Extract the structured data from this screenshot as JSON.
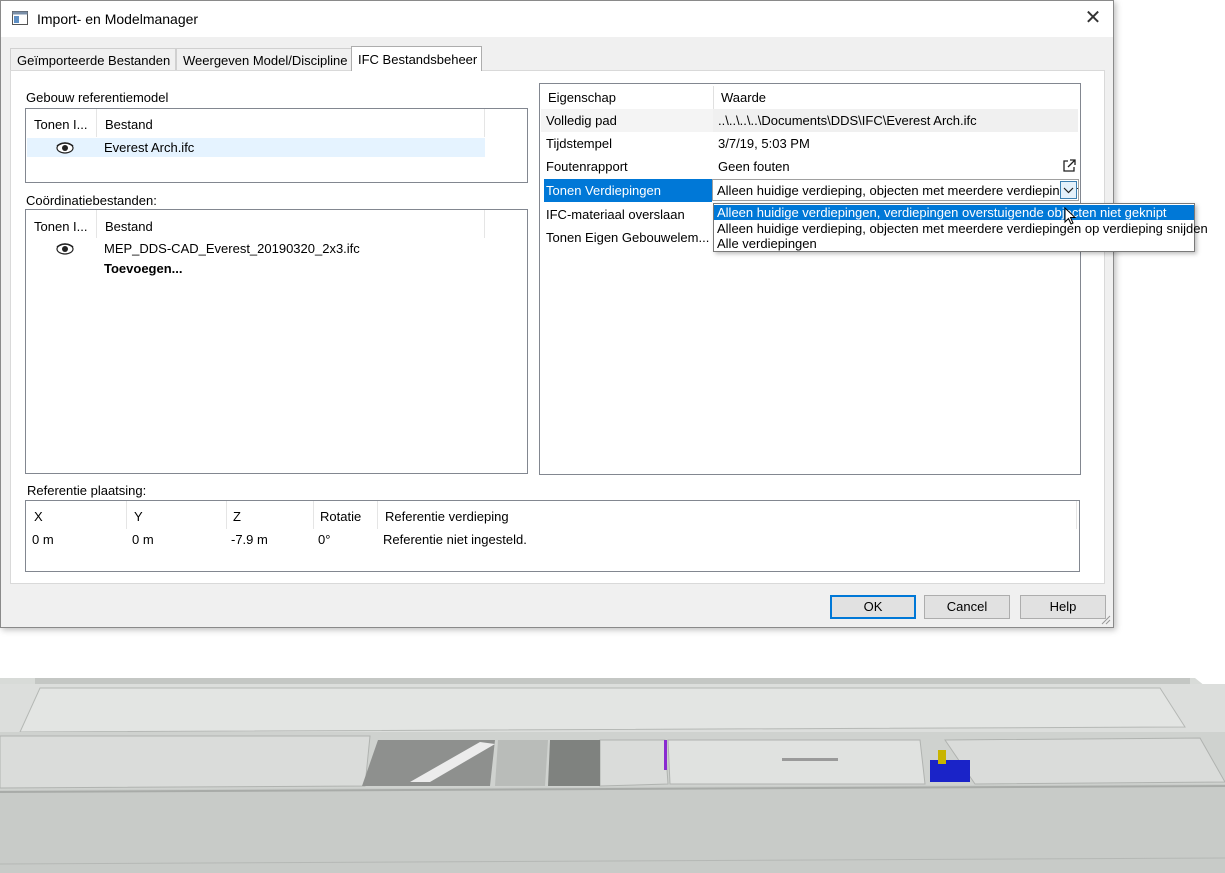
{
  "window": {
    "title": "Import- en Modelmanager",
    "close_glyph": "✕",
    "icon": "app-window-icon"
  },
  "tabs": [
    {
      "label": "Geïmporteerde Bestanden",
      "active": false
    },
    {
      "label": "Weergeven Model/Discipline",
      "active": false
    },
    {
      "label": "IFC Bestandsbeheer",
      "active": true
    }
  ],
  "reference_model": {
    "label": "Gebouw referentiemodel",
    "columns": [
      "Tonen I...",
      "Bestand"
    ],
    "rows": [
      {
        "visible_icon": "eye-icon",
        "file": "Everest Arch.ifc"
      }
    ]
  },
  "coordination_files": {
    "label": "Coördinatiebestanden:",
    "columns": [
      "Tonen I...",
      "Bestand"
    ],
    "rows": [
      {
        "visible_icon": "eye-icon",
        "file": "MEP_DDS-CAD_Everest_20190320_2x3.ifc"
      }
    ],
    "add_label": "Toevoegen..."
  },
  "properties": {
    "header": {
      "name": "Eigenschap",
      "value": "Waarde"
    },
    "rows": [
      {
        "name": "Volledig pad",
        "value": "..\\..\\..\\..\\Documents\\DDS\\IFC\\Everest Arch.ifc"
      },
      {
        "name": "Tijdstempel",
        "value": "3/7/19, 5:03 PM"
      },
      {
        "name": "Foutenrapport",
        "value": "Geen fouten"
      },
      {
        "name": "Tonen Verdiepingen",
        "value": "Alleen huidige verdieping, objecten met meerdere verdiepingen"
      },
      {
        "name": "IFC-materiaal overslaan",
        "value": ""
      },
      {
        "name": "Tonen Eigen Gebouwelem...",
        "value": ""
      }
    ],
    "dropdown_options": [
      "Alleen huidige verdiepingen, verdiepingen overstuigende objecten niet geknipt",
      "Alleen huidige verdieping, objecten met meerdere verdiepingen op verdieping snijden",
      "Alle verdiepingen"
    ],
    "highlighted_option_index": 0
  },
  "reference_placement": {
    "label": "Referentie plaatsing:",
    "columns": [
      "X",
      "Y",
      "Z",
      "Rotatie",
      "Referentie verdieping"
    ],
    "values": [
      "0 m",
      "0 m",
      "-7.9 m",
      "0°",
      "Referentie niet ingesteld."
    ]
  },
  "buttons": {
    "ok": "OK",
    "cancel": "Cancel",
    "help": "Help"
  },
  "colors": {
    "selection": "#0078d7",
    "selected_row": "#e5f3ff"
  }
}
